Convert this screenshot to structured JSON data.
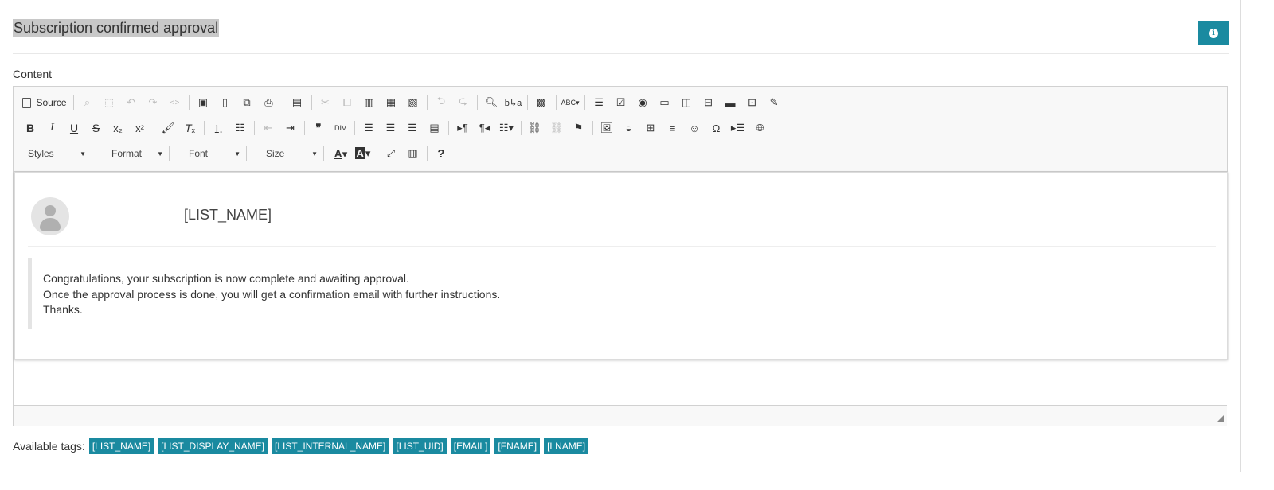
{
  "header": {
    "title": "Subscription confirmed approval",
    "info_icon": "info-icon"
  },
  "field": {
    "label": "Content"
  },
  "toolbar": {
    "source_label": "Source",
    "row1_icons": [
      "source-icon",
      "find-icon",
      "select-all-icon",
      "undo-arrow-icon",
      "redo-arrow-icon",
      "code-icon",
      "save-icon",
      "new-page-icon",
      "preview-icon",
      "print-icon",
      "templates-icon",
      "cut-icon",
      "copy-icon",
      "paste-icon",
      "paste-text-icon",
      "paste-word-icon",
      "undo-icon",
      "redo-icon",
      "search-icon",
      "replace-icon",
      "select-all-block-icon",
      "spellcheck-icon",
      "form-icon",
      "checkbox-icon",
      "radio-icon",
      "text-field-icon",
      "textarea-icon",
      "select-icon",
      "button-icon",
      "image-button-icon",
      "hidden-field-icon"
    ],
    "row2_icons": [
      "bold-icon",
      "italic-icon",
      "underline-icon",
      "strikethrough-icon",
      "subscript-icon",
      "superscript-icon",
      "copy-format-icon",
      "remove-format-icon",
      "numbered-list-icon",
      "bulleted-list-icon",
      "decrease-indent-icon",
      "increase-indent-icon",
      "blockquote-icon",
      "div-container-icon",
      "align-left-icon",
      "align-center-icon",
      "align-right-icon",
      "justify-icon",
      "ltr-icon",
      "rtl-icon",
      "language-icon",
      "link-icon",
      "unlink-icon",
      "anchor-icon",
      "image-icon",
      "flash-icon",
      "table-icon",
      "horizontal-line-icon",
      "smiley-icon",
      "special-char-icon",
      "page-break-icon",
      "iframe-icon"
    ],
    "combos": {
      "styles": "Styles",
      "format": "Format",
      "font": "Font",
      "size": "Size"
    },
    "help_label": "?"
  },
  "content": {
    "list_name": "[LIST_NAME]",
    "lines": [
      "Congratulations, your subscription is now complete and awaiting approval.",
      "Once the approval process is done, you will get a confirmation email with further instructions.",
      "Thanks."
    ]
  },
  "tags": {
    "label": "Available tags:",
    "items": [
      "[LIST_NAME]",
      "[LIST_DISPLAY_NAME]",
      "[LIST_INTERNAL_NAME]",
      "[LIST_UID]",
      "[EMAIL]",
      "[FNAME]",
      "[LNAME]"
    ]
  },
  "colors": {
    "accent": "#1a8aa0",
    "title_highlight": "#c8c8c8"
  }
}
